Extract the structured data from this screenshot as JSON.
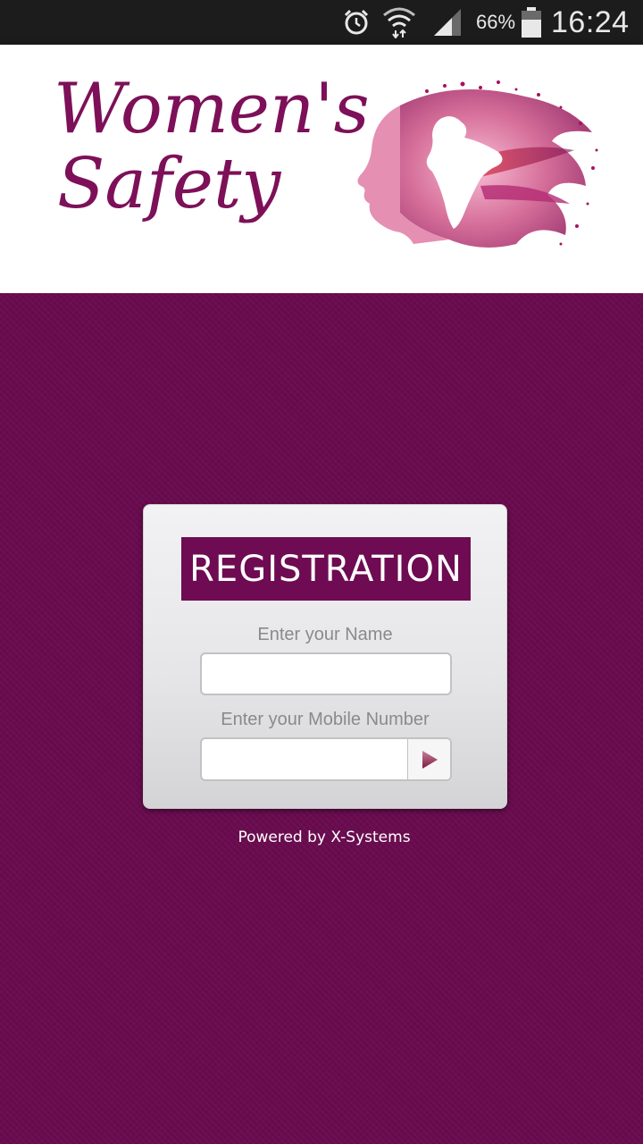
{
  "status_bar": {
    "icons": [
      "alarm-icon",
      "wifi-icon",
      "signal-icon",
      "battery-icon"
    ],
    "battery_percent": "66%",
    "time": "16:24"
  },
  "header": {
    "logo_line1": "Women's",
    "logo_line2": "Safety",
    "logo_art": "woman-silhouette-india-map"
  },
  "registration": {
    "title": "REGISTRATION",
    "name_label": "Enter your Name",
    "name_value": "",
    "mobile_label": "Enter your Mobile Number",
    "mobile_value": "",
    "submit_icon": "play-arrow-icon"
  },
  "footer": {
    "powered_by": "Powered by X-Systems"
  },
  "colors": {
    "brand": "#6a0b4f",
    "logo_text": "#7d1058"
  }
}
